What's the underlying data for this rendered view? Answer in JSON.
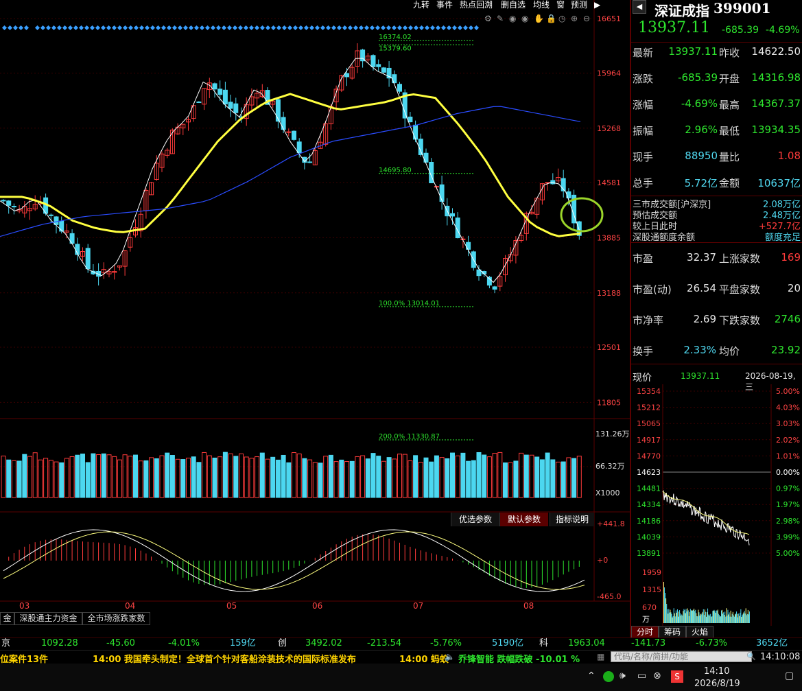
{
  "colors": {
    "up": "#ff3b3b",
    "down": "#4cd7f0",
    "ma_yellow": "#ffff40",
    "ma_blue": "#2a4cff",
    "accent_green": "#2ee62e",
    "marker": "#9bd52a"
  },
  "toolbar": [
    "九转",
    "事件",
    "热点回溯",
    "删自选",
    "均线",
    "窗",
    "预测"
  ],
  "toolbar_icons": [
    "gear-icon",
    "brush-icon",
    "eye-icon",
    "eye-icon",
    "hand-icon",
    "lock-icon",
    "clock-icon",
    "zoom-in-icon",
    "zoom-out-icon"
  ],
  "header": {
    "name": "深证成指",
    "code": "399001",
    "price": "13937.11",
    "change": "-685.39",
    "change_pct": "-4.69%"
  },
  "quote": [
    {
      "k": "最新",
      "v": "13937.11",
      "vc": "green",
      "k2": "昨收",
      "v2": "14622.50",
      "v2c": "white"
    },
    {
      "k": "涨跌",
      "v": "-685.39",
      "vc": "green",
      "k2": "开盘",
      "v2": "14316.98",
      "v2c": "green"
    },
    {
      "k": "涨幅",
      "v": "-4.69%",
      "vc": "green",
      "k2": "最高",
      "v2": "14367.37",
      "v2c": "green"
    },
    {
      "k": "振幅",
      "v": "2.96%",
      "vc": "green",
      "k2": "最低",
      "v2": "13934.35",
      "v2c": "green"
    },
    {
      "k": "现手",
      "v": "88950",
      "vc": "cyan",
      "k2": "量比",
      "v2": "1.08",
      "v2c": "red"
    },
    {
      "k": "总手",
      "v": "5.72亿",
      "vc": "cyan",
      "k2": "金额",
      "v2": "10637亿",
      "v2c": "cyan"
    }
  ],
  "turnover": [
    {
      "k": "三市成交额[沪深京]",
      "v": "2.08万亿",
      "vc": "cyan"
    },
    {
      "k": "预估成交额",
      "v": "2.48万亿",
      "vc": "cyan"
    },
    {
      "k": "较上日此时",
      "v": "+527.7亿",
      "vc": "red"
    },
    {
      "k": "深股通额度余额",
      "v": "额度充足",
      "vc": "cyan"
    }
  ],
  "stats": [
    {
      "k": "市盈",
      "v": "32.37",
      "k2": "上涨家数",
      "v2": "169",
      "v2c": "red"
    },
    {
      "k": "市盈(动)",
      "v": "26.54",
      "k2": "平盘家数",
      "v2": "20",
      "v2c": "white"
    },
    {
      "k": "市净率",
      "v": "2.69",
      "k2": "下跌家数",
      "v2": "2746",
      "v2c": "green"
    },
    {
      "k": "换手",
      "v": "2.33%",
      "vc": "cyan",
      "k2": "均价",
      "v2": "23.92",
      "v2c": "green"
    }
  ],
  "intraday": {
    "label": "现价",
    "price": "13937.11",
    "datetime": "2026-08-19,三",
    "left_ticks": [
      "15354",
      "15212",
      "15065",
      "14917",
      "14770",
      "14623",
      "14481",
      "14334",
      "14186",
      "14039",
      "13891"
    ],
    "right_ticks": [
      "5.00%",
      "4.03%",
      "3.03%",
      "2.02%",
      "1.01%",
      "0.00%",
      "0.97%",
      "1.97%",
      "2.98%",
      "3.99%",
      "5.00%"
    ],
    "vol_ticks": [
      "1959",
      "1315",
      "670",
      "万"
    ],
    "tabs": [
      "分时",
      "筹码",
      "火焰"
    ]
  },
  "kline": {
    "y_ticks": [
      "16651",
      "15964",
      "15268",
      "14581",
      "13885",
      "13188",
      "12501",
      "11805"
    ],
    "x_ticks": [
      "03",
      "04",
      "05",
      "06",
      "07",
      "08"
    ],
    "fib": [
      {
        "label": "16374.02",
        "value": 16374.02
      },
      {
        "label": "15379.60",
        "value": 16321
      },
      {
        "label": "14695.80",
        "value": 14695.8
      },
      {
        "label": "100.0%  13014.01",
        "value": 13014.01
      },
      {
        "label": "200.0%  11330.87",
        "value": 11330.87
      }
    ],
    "fib_top_label": "16374.02",
    "vol_ticks": [
      "131.26万",
      "66.32万",
      "X1000"
    ],
    "macd_ticks": [
      "+441.8",
      "+0",
      "-465.0"
    ],
    "indicator_buttons": [
      "优选参数",
      "默认参数",
      "指标说明"
    ],
    "bottom_tabs": [
      "金",
      "深股通主力资金",
      "全市场涨跌家数"
    ]
  },
  "chart_data": {
    "type": "candlestick",
    "title": "深证成指 399001",
    "x_labels": [
      "03",
      "04",
      "05",
      "06",
      "07",
      "08"
    ],
    "ylim": [
      11400,
      16900
    ],
    "close_series_approx": [
      14350,
      14200,
      14400,
      14100,
      13900,
      13500,
      13400,
      13600,
      14200,
      14800,
      15200,
      15400,
      15900,
      15600,
      15400,
      15800,
      15500,
      15100,
      14800,
      15300,
      15900,
      16200,
      16000,
      15900,
      15300,
      14800,
      14300,
      13900,
      13500,
      13300,
      13700,
      14200,
      14600,
      14550,
      13940
    ],
    "ma_yellow_approx": [
      14400,
      14400,
      14300,
      14100,
      14000,
      13950,
      14000,
      14300,
      14700,
      15100,
      15400,
      15600,
      15700,
      15600,
      15500,
      15550,
      15600,
      15700,
      15650,
      15300,
      14900,
      14400,
      14050,
      13900,
      13937
    ],
    "ma_blue_approx": [
      13900,
      14050,
      14150,
      14200,
      14250,
      14350,
      14600,
      14900,
      15100,
      15200,
      15300,
      15450,
      15550,
      15450,
      15350
    ]
  },
  "ticker": [
    {
      "t": "京",
      "c": "white"
    },
    {
      "t": "1092.28",
      "c": "green"
    },
    {
      "t": "-45.60",
      "c": "green"
    },
    {
      "t": "-4.01%",
      "c": "green"
    },
    {
      "t": "159亿",
      "c": "cyan"
    },
    {
      "t": "创",
      "c": "white"
    },
    {
      "t": "3492.02",
      "c": "green"
    },
    {
      "t": "-213.54",
      "c": "green"
    },
    {
      "t": "-5.76%",
      "c": "green"
    },
    {
      "t": "5190亿",
      "c": "cyan"
    },
    {
      "t": "科",
      "c": "white"
    },
    {
      "t": "1963.04",
      "c": "green"
    },
    {
      "t": "-141.73",
      "c": "green"
    },
    {
      "t": "-6.73%",
      "c": "green"
    },
    {
      "t": "3652亿",
      "c": "cyan"
    }
  ],
  "news": {
    "left": "位案件13件",
    "headline": "14:00 我国牵头制定！全球首个针对客船涂装技术的国际标准发布",
    "headline2": "14:00 蚂蚁",
    "alert": "乔锋智能  跌幅跌破  -10.01 %",
    "search_placeholder": "代码/名称/简拼/功能",
    "clock": "14:10:08"
  },
  "taskbar": {
    "time": "14:10",
    "date": "2026/8/19"
  }
}
